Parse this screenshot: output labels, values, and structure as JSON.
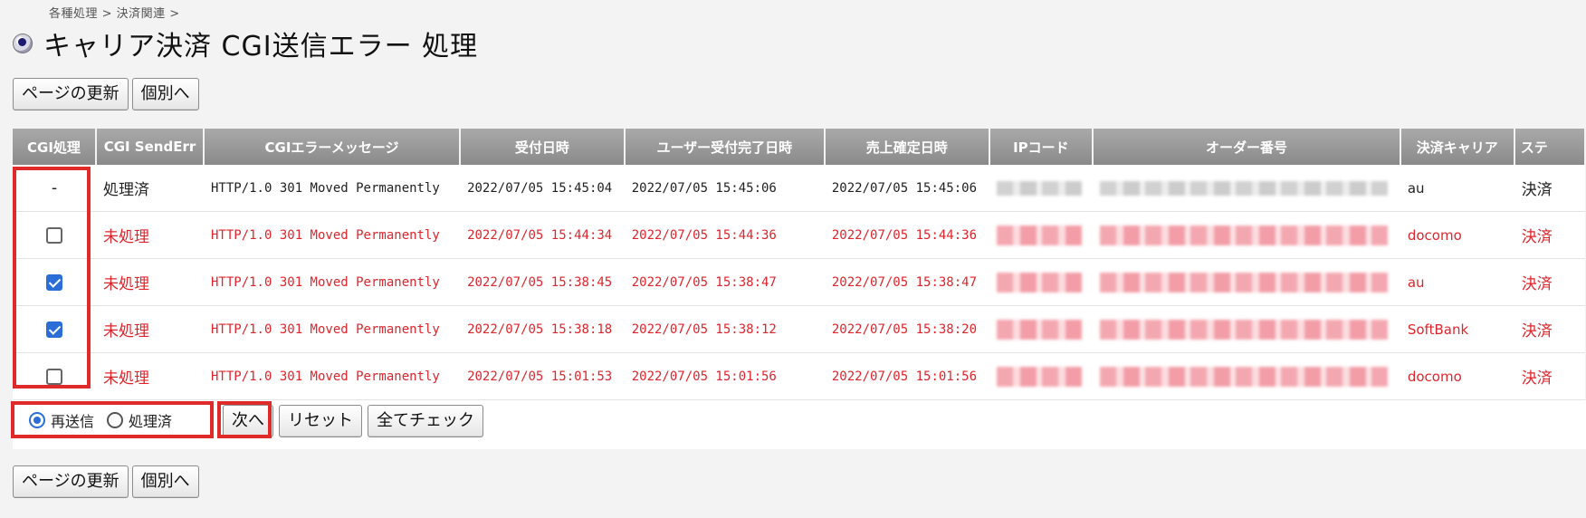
{
  "breadcrumb": "各種処理 > 決済関連 >",
  "page_title": "キャリア決済 CGI送信エラー 処理",
  "buttons": {
    "refresh": "ページの更新",
    "individual": "個別へ",
    "next": "次へ",
    "reset": "リセット",
    "check_all": "全てチェック"
  },
  "table": {
    "headers": [
      "CGI処理",
      "CGI SendErr",
      "CGIエラーメッセージ",
      "受付日時",
      "ユーザー受付完了日時",
      "売上確定日時",
      "IPコード",
      "オーダー番号",
      "決済キャリア",
      "ステ"
    ],
    "rows": [
      {
        "state": "done",
        "check": "-",
        "send_err": "処理済",
        "message": "HTTP/1.0 301 Moved Permanently",
        "received": "2022/07/05 15:45:04",
        "user_done": "2022/07/05 15:45:06",
        "sale_fixed": "2022/07/05 15:45:06",
        "carrier": "au",
        "status": "決済"
      },
      {
        "state": "pending",
        "check": "unchecked",
        "send_err": "未処理",
        "message": "HTTP/1.0 301 Moved Permanently",
        "received": "2022/07/05 15:44:34",
        "user_done": "2022/07/05 15:44:36",
        "sale_fixed": "2022/07/05 15:44:36",
        "carrier": "docomo",
        "status": "決済"
      },
      {
        "state": "pending",
        "check": "checked",
        "send_err": "未処理",
        "message": "HTTP/1.0 301 Moved Permanently",
        "received": "2022/07/05 15:38:45",
        "user_done": "2022/07/05 15:38:47",
        "sale_fixed": "2022/07/05 15:38:47",
        "carrier": "au",
        "status": "決済"
      },
      {
        "state": "pending",
        "check": "checked",
        "send_err": "未処理",
        "message": "HTTP/1.0 301 Moved Permanently",
        "received": "2022/07/05 15:38:18",
        "user_done": "2022/07/05 15:38:12",
        "sale_fixed": "2022/07/05 15:38:20",
        "carrier": "SoftBank",
        "status": "決済"
      },
      {
        "state": "pending",
        "check": "unchecked",
        "send_err": "未処理",
        "message": "HTTP/1.0 301 Moved Permanently",
        "received": "2022/07/05 15:01:53",
        "user_done": "2022/07/05 15:01:56",
        "sale_fixed": "2022/07/05 15:01:56",
        "carrier": "docomo",
        "status": "決済"
      }
    ]
  },
  "radio": {
    "resend": "再送信",
    "processed": "処理済",
    "selected": "resend"
  },
  "colors": {
    "pending_text": "#e0242b",
    "highlight": "#e02a2a",
    "check_accent": "#2b6ed7",
    "header_bg": "#999999"
  }
}
